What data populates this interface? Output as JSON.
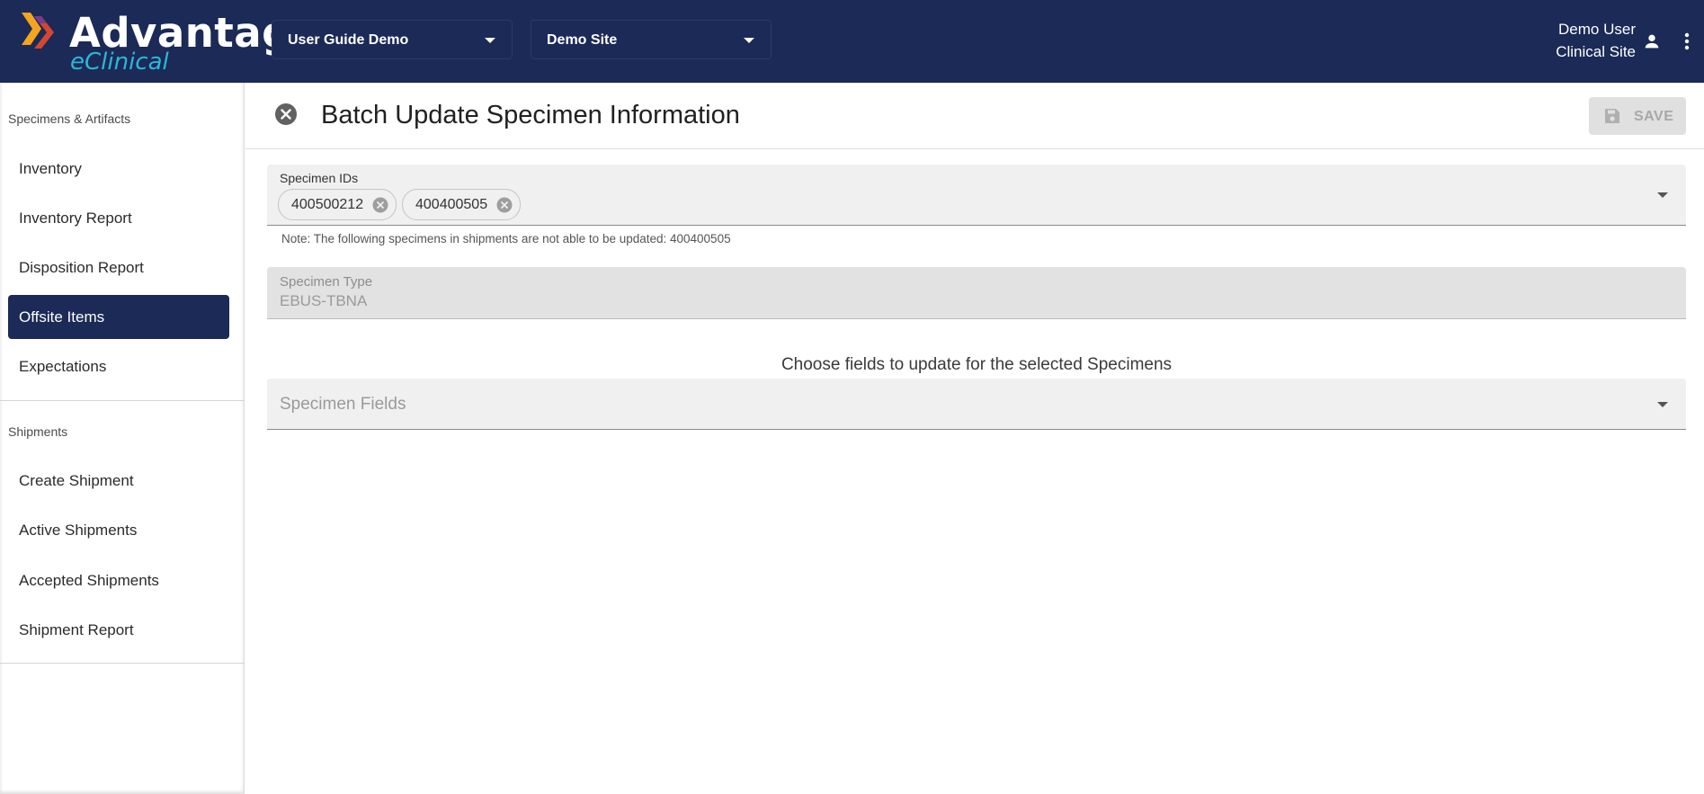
{
  "brand": {
    "name": "Advantage",
    "subtitle": "eClinical"
  },
  "header": {
    "study_select": "User Guide Demo",
    "site_select": "Demo Site",
    "user_name": "Demo User",
    "user_role": "Clinical Site"
  },
  "sidebar": {
    "sections": [
      {
        "title": "Specimens & Artifacts",
        "items": [
          {
            "label": "Inventory",
            "active": false
          },
          {
            "label": "Inventory Report",
            "active": false
          },
          {
            "label": "Disposition Report",
            "active": false
          },
          {
            "label": "Offsite Items",
            "active": true
          },
          {
            "label": "Expectations",
            "active": false
          }
        ]
      },
      {
        "title": "Shipments",
        "items": [
          {
            "label": "Create Shipment",
            "active": false
          },
          {
            "label": "Active Shipments",
            "active": false
          },
          {
            "label": "Accepted Shipments",
            "active": false
          },
          {
            "label": "Shipment Report",
            "active": false
          }
        ]
      }
    ]
  },
  "main": {
    "title": "Batch Update Specimen Information",
    "save_label": "SAVE",
    "specimen_ids": {
      "label": "Specimen IDs",
      "chips": [
        "400500212",
        "400400505"
      ]
    },
    "note": "Note: The following specimens in shipments are not able to be updated: 400400505",
    "specimen_type": {
      "label": "Specimen Type",
      "value": "EBUS-TBNA"
    },
    "choose_text": "Choose fields to update for the selected Specimens",
    "specimen_fields": {
      "placeholder": "Specimen Fields"
    }
  },
  "colors": {
    "header_bg": "#1b2a57",
    "accent_cyan": "#2cb6d6",
    "active_nav_bg": "#1b2a57"
  }
}
